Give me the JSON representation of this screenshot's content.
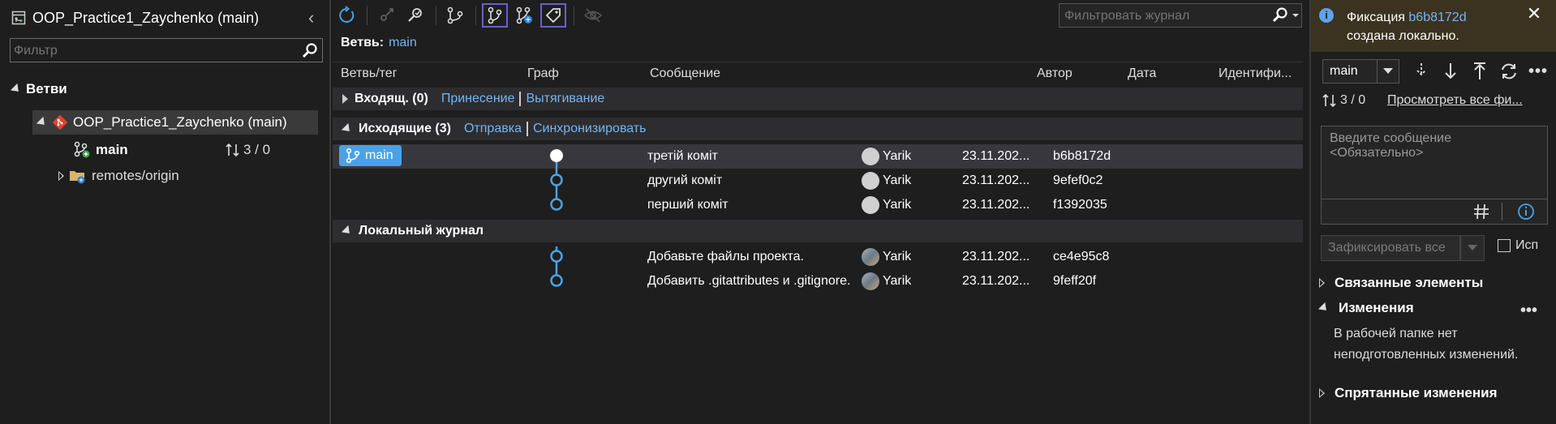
{
  "left": {
    "title": "OOP_Practice1_Zaychenko (main)",
    "filter_placeholder": "Фильтр",
    "branches_label": "Ветви",
    "repo_label": "OOP_Practice1_Zaychenko (main)",
    "main_label": "main",
    "main_counts": "3 / 0",
    "remotes_label": "remotes/origin"
  },
  "center": {
    "journal_filter_placeholder": "Фильтровать журнал",
    "branch_prefix": "Ветвь:",
    "branch_name": "main",
    "columns": {
      "branch_tag": "Ветвь/тег",
      "graph": "Граф",
      "message": "Сообщение",
      "author": "Автор",
      "date": "Дата",
      "id": "Идентифи..."
    },
    "incoming": {
      "label": "Входящ. (0)",
      "fetch": "Принесение",
      "pull": "Вытягивание"
    },
    "outgoing": {
      "label": "Исходящие (3)",
      "push": "Отправка",
      "sync": "Синхронизировать"
    },
    "branch_tag": "main",
    "outgoing_commits": [
      {
        "message": "третій коміт",
        "author": "Yarik",
        "date": "23.11.202...",
        "hash": "b6b8172d"
      },
      {
        "message": "другий коміт",
        "author": "Yarik",
        "date": "23.11.202...",
        "hash": "9efef0c2"
      },
      {
        "message": "перший коміт",
        "author": "Yarik",
        "date": "23.11.202...",
        "hash": "f1392035"
      }
    ],
    "local_label": "Локальный журнал",
    "local_commits": [
      {
        "message": "Добавьте файлы проекта.",
        "author": "Yarik",
        "date": "23.11.202...",
        "hash": "ce4e95c8"
      },
      {
        "message": "Добавить .gitattributes и .gitignore.",
        "author": "Yarik",
        "date": "23.11.202...",
        "hash": "9feff20f"
      }
    ]
  },
  "right": {
    "notif_prefix": "Фиксация",
    "notif_hash": "b6b8172d",
    "notif_suffix": "создана локально.",
    "branch": "main",
    "counts": "3 / 0",
    "view_all": "Просмотреть все фи...",
    "message_placeholder": "Введите сообщение\n<Обязательно>",
    "commit_all": "Зафиксировать все",
    "amend": "Исп",
    "related": "Связанные элементы",
    "changes": "Изменения",
    "changes_text": "В рабочей папке нет неподготовленных изменений.",
    "stashes": "Спрятанные изменения"
  },
  "colors": {
    "accent": "#75b5f0",
    "graph": "#4aa2e6",
    "highlight_box": "#6b5fcf",
    "notification_bg": "#3b3220"
  }
}
